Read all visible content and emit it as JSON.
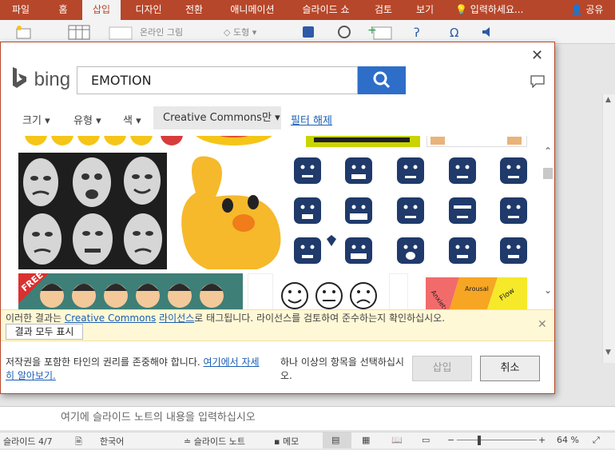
{
  "ribbon": {
    "tabs": [
      "파일",
      "홈",
      "삽입",
      "디자인",
      "전환",
      "애니메이션",
      "슬라이드 쇼",
      "검토",
      "보기"
    ],
    "active_tab": "삽입",
    "tell_me": "입력하세요...",
    "share": "공유",
    "online_pictures": "온라인 그림",
    "shapes": "도형"
  },
  "dialog": {
    "search_query": "EMOTION",
    "filters": {
      "size": "크기",
      "type": "유형",
      "color": "색",
      "creative_commons": "Creative Commons만",
      "clear": "필터 해제"
    },
    "notice": {
      "prefix": "이러한 결과는 ",
      "link1": "Creative Commons",
      "space": " ",
      "link2": "라이선스",
      "suffix": "로 태그됩니다. 라이선스를 검토하여 준수하는지 확인하십시오.",
      "show_all": "결과 모두 표시"
    },
    "footer": {
      "rights": "저작권을 포함한 타인의 권리를 존중해야 합니다. ",
      "rights_link": "여기에서 자세히 알아보기.",
      "select_hint": "하나 이상의 항목을 선택하십시오.",
      "insert": "삽입",
      "cancel": "취소"
    },
    "thumb_labels": {
      "free": "FREE",
      "arousal": "Arousal",
      "anxiety": "Anxiety",
      "flow": "Flow"
    }
  },
  "notes": {
    "placeholder": "여기에 슬라이드 노트의 내용을 입력하십시오"
  },
  "status": {
    "slide": "슬라이드 4/7",
    "language": "한국어",
    "notes_btn": "슬라이드 노트",
    "comments": "메모",
    "zoom": "64 %"
  },
  "colors": {
    "accent": "#b7472a",
    "bing_blue": "#2e6ec8",
    "emoji_navy": "#1f3a6b",
    "emoji_yellow": "#f5c518"
  }
}
